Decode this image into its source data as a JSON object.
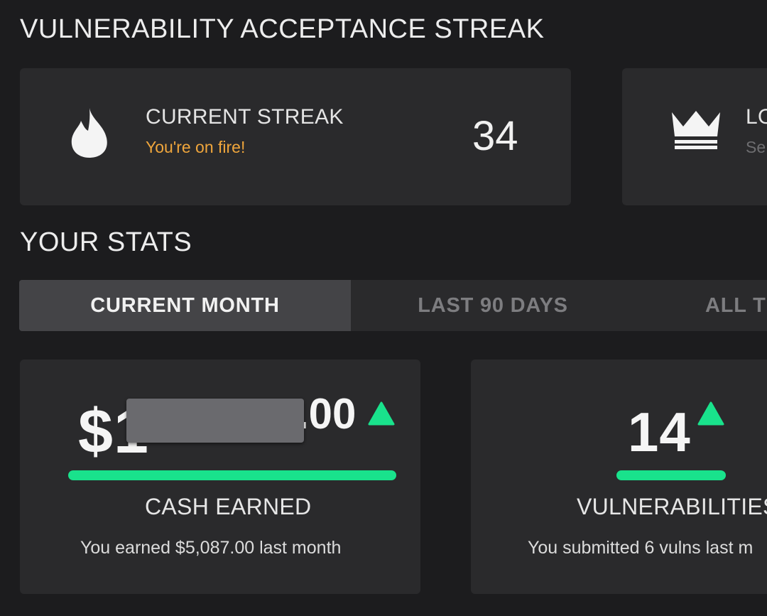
{
  "colors": {
    "accent_green": "#19e28c",
    "streak_orange": "#f0a63c",
    "muted_text": "#6d6d70"
  },
  "streak_section": {
    "title": "VULNERABILITY ACCEPTANCE STREAK",
    "current": {
      "icon": "fire-icon",
      "label": "CURRENT STREAK",
      "subtitle": "You're on fire!",
      "value": "34"
    },
    "longest": {
      "icon": "crown-icon",
      "label": "LO",
      "subtitle": "Se"
    }
  },
  "stats_section": {
    "title": "YOUR STATS",
    "tabs": [
      {
        "label": "CURRENT MONTH",
        "active": true
      },
      {
        "label": "LAST 90 DAYS",
        "active": false
      },
      {
        "label": "ALL TI",
        "active": false
      }
    ],
    "cash": {
      "value_prefix": "$1",
      "value_suffix": ".00",
      "trend_icon": "up-arrow-icon",
      "label": "CASH EARNED",
      "note": "You earned $5,087.00 last month"
    },
    "vulns": {
      "value": "14",
      "trend_icon": "up-arrow-icon",
      "label": "VULNERABILITIES",
      "note": "You submitted 6 vulns last m"
    }
  }
}
